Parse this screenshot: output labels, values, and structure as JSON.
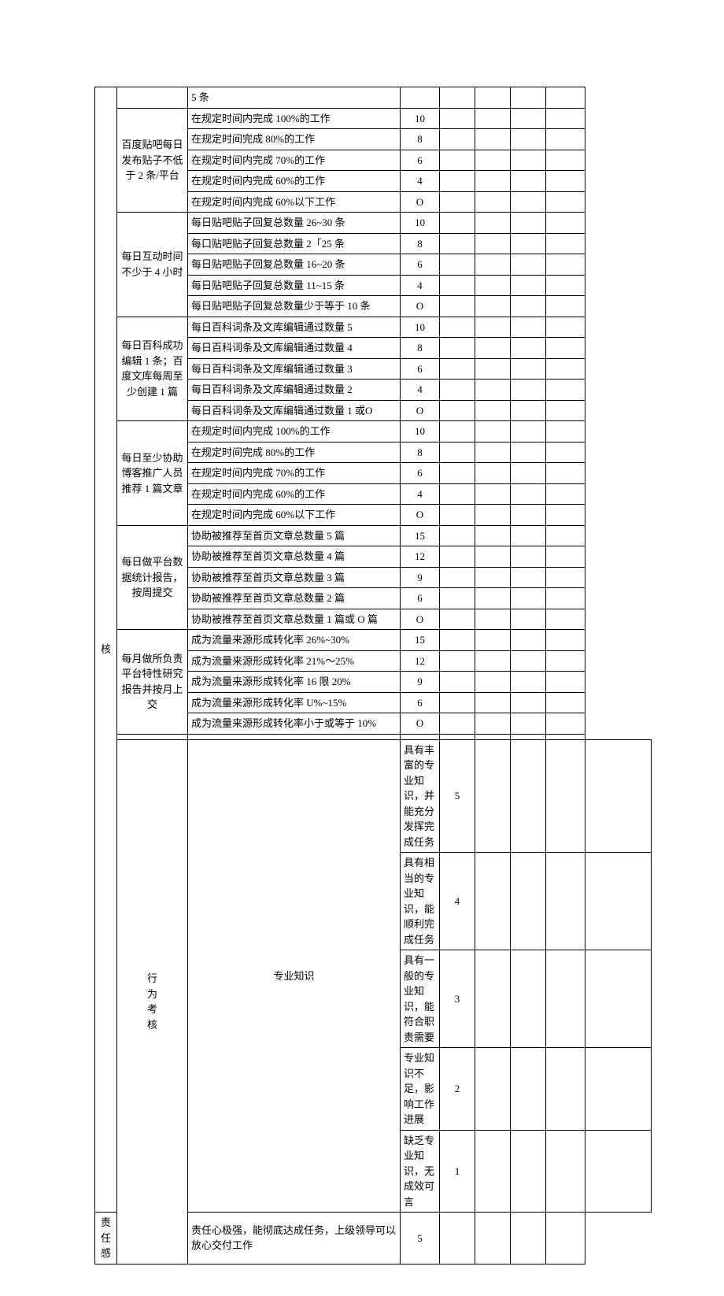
{
  "sections": [
    {
      "category": "核",
      "category_rowspan": 37,
      "groups": [
        {
          "label": "",
          "rowspan": 1,
          "rows": [
            {
              "desc": "5 条",
              "score": ""
            }
          ]
        },
        {
          "label": "百度贴吧每日发布贴子不低于 2 条/平台",
          "rowspan": 5,
          "rows": [
            {
              "desc": "在规定时间内完成 100%的工作",
              "score": "10"
            },
            {
              "desc": "在规定时间完成 80%的工作",
              "score": "8"
            },
            {
              "desc": "在规定时间内完成 70%的工作",
              "score": "6"
            },
            {
              "desc": "在规定时间内完成 60%的工作",
              "score": "4"
            },
            {
              "desc": "在规定时间内完成 60%以下工作",
              "score": "O"
            }
          ]
        },
        {
          "label": "每日互动时间不少于 4 小时",
          "rowspan": 5,
          "rows": [
            {
              "desc": "每日贴吧贴子回复总数量 26~30 条",
              "score": "10"
            },
            {
              "desc": "每口贴吧贴子回复总数量 2「25 条",
              "score": "8"
            },
            {
              "desc": "每日贴吧贴子回复总数量 16~20 条",
              "score": "6"
            },
            {
              "desc": "每日贴吧贴子回复总数量 11~15 条",
              "score": "4"
            },
            {
              "desc": "每日贴吧贴子回复总数量少于等于 10 条",
              "score": "O"
            }
          ]
        },
        {
          "label": "每日百科成功编辑 1 条；百度文库每周至少创建 1 篇",
          "rowspan": 5,
          "rows": [
            {
              "desc": "每日百科词条及文库编辑通过数量 5",
              "score": "10"
            },
            {
              "desc": "每日百科词条及文库编辑通过数量 4",
              "score": "8"
            },
            {
              "desc": "每日百科词条及文库编辑通过数量 3",
              "score": "6"
            },
            {
              "desc": "每日百科词条及文库编辑通过数量 2",
              "score": "4"
            },
            {
              "desc": "每日百科词条及文库编辑通过数量 1 或O",
              "score": "O"
            }
          ]
        },
        {
          "label": "每日至少协助博客推广人员推荐 1 篇文章",
          "rowspan": 5,
          "rows": [
            {
              "desc": "在规定时间内完成 100%的工作",
              "score": "10"
            },
            {
              "desc": "在规定时间完成 80%的工作",
              "score": "8"
            },
            {
              "desc": "在规定时间内完成 70%的工作",
              "score": "6"
            },
            {
              "desc": "在规定时间内完成 60%的工作",
              "score": "4"
            },
            {
              "desc": "在规定时间内完成 60%以下工作",
              "score": "O"
            }
          ]
        },
        {
          "label": "每日做平台数据统计报告，按周提交",
          "rowspan": 5,
          "rows": [
            {
              "desc": "协助被推荐至首页文章总数量 5 篇",
              "score": "15"
            },
            {
              "desc": "协助被推荐至首页文章总数量 4 篇",
              "score": "12"
            },
            {
              "desc": "协助被推荐至首页文章总数量 3 篇",
              "score": "9"
            },
            {
              "desc": "协助被推荐至首页文章总数量 2 篇",
              "score": "6"
            },
            {
              "desc": "协助被推荐至首页文章总数量 1 篇或 O 篇",
              "score": "O"
            }
          ]
        },
        {
          "label": "每月做所负责平台特性研究报告并按月上交",
          "rowspan": 5,
          "rows": [
            {
              "desc": "成为流量来源形成转化率 26%~30%",
              "score": "15"
            },
            {
              "desc": "成为流量来源形成转化率 21%〜25%",
              "score": "12"
            },
            {
              "desc": "成为流量来源形成转化率 16 限 20%",
              "score": "9"
            },
            {
              "desc": "成为流量来源形成转化率 U%~15%",
              "score": "6"
            },
            {
              "desc": "成为流量来源形成转化率小于或等于 10%",
              "score": "O"
            }
          ]
        },
        {
          "label": "",
          "rowspan": 1,
          "rows": [
            {
              "desc": "",
              "score": ""
            }
          ]
        }
      ]
    },
    {
      "category": "行为考核",
      "category_rowspan": 6,
      "groups": [
        {
          "label": "专业知识",
          "rowspan": 5,
          "rows": [
            {
              "desc": "具有丰富的专业知识，并能充分发挥完成任务",
              "score": "5"
            },
            {
              "desc": "具有相当的专业知识，能顺利完成任务",
              "score": "4"
            },
            {
              "desc": "具有一般的专业知识，能符合职责需要",
              "score": "3"
            },
            {
              "desc": "专业知识不足，影响工作进展",
              "score": "2"
            },
            {
              "desc": "缺乏专业知识，无成效可言",
              "score": "1"
            }
          ]
        },
        {
          "label": "责任感",
          "rowspan": 1,
          "rows": [
            {
              "desc": "责任心极强，能彻底达成任务，上级领导可以放心交付工作",
              "score": "5"
            }
          ]
        }
      ]
    }
  ]
}
